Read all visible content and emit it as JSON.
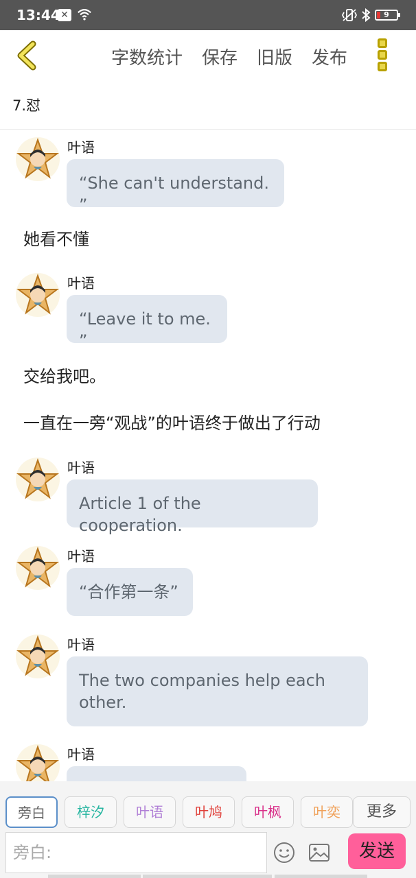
{
  "status_bar": {
    "time": "13:44",
    "battery": "9"
  },
  "toolbar": {
    "actions": [
      "字数统计",
      "保存",
      "旧版",
      "发布"
    ]
  },
  "chapter": {
    "title": "7.怼"
  },
  "messages": [
    {
      "type": "dialogue",
      "speaker": "叶语",
      "text": "“She can't understand. ”"
    },
    {
      "type": "narration",
      "text": "她看不懂"
    },
    {
      "type": "dialogue",
      "speaker": "叶语",
      "text": "“Leave it to me. ”"
    },
    {
      "type": "narration",
      "text": "交给我吧。"
    },
    {
      "type": "narration",
      "text": "一直在一旁“观战”的叶语终于做出了行动"
    },
    {
      "type": "dialogue",
      "speaker": "叶语",
      "text": "Article 1 of the cooperation."
    },
    {
      "type": "dialogue",
      "speaker": "叶语",
      "text": "“合作第一条”"
    },
    {
      "type": "dialogue",
      "speaker": "叶语",
      "text": "The two companies help each other."
    },
    {
      "type": "dialogue",
      "speaker": "叶语",
      "text": ""
    }
  ],
  "composer": {
    "roles": [
      {
        "label": "旁白",
        "color": "#666666"
      },
      {
        "label": "梓汐",
        "color": "#26b5a0"
      },
      {
        "label": "叶语",
        "color": "#b07fd6"
      },
      {
        "label": "叶鸠",
        "color": "#e0403a"
      },
      {
        "label": "叶枫",
        "color": "#d9318a"
      },
      {
        "label": "叶奕",
        "color": "#f0a15a"
      }
    ],
    "more_label": "更多",
    "input_placeholder": "旁白:",
    "send_label": "发送"
  }
}
